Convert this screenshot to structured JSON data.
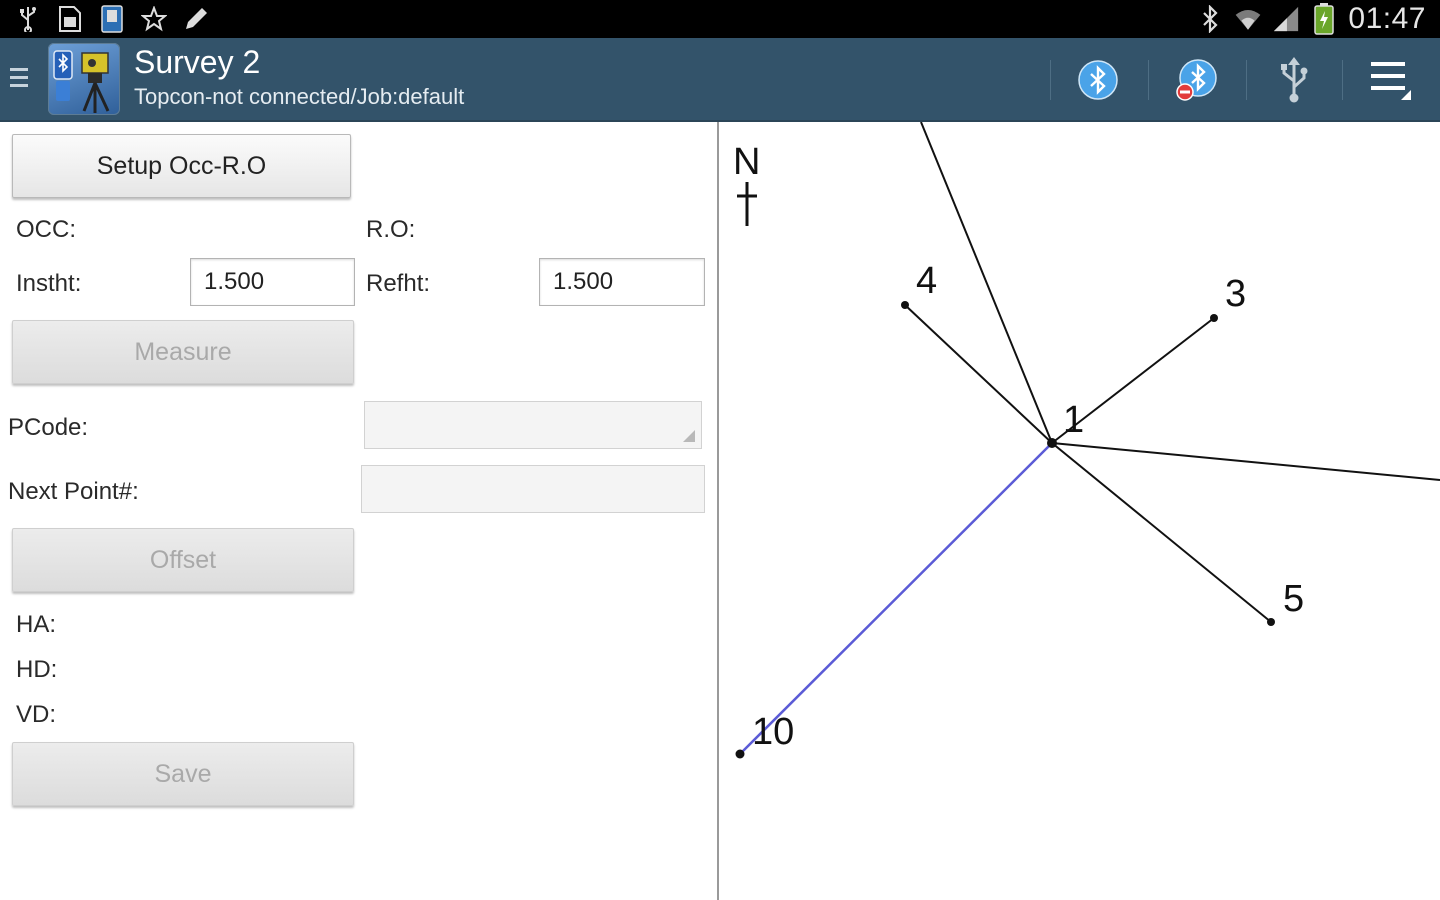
{
  "status_bar": {
    "time": "01:47",
    "left_icons": [
      "usb-icon",
      "sd-card-icon",
      "app-notification-icon",
      "star-icon",
      "pencil-icon"
    ],
    "right_icons": [
      "bluetooth-icon",
      "wifi-icon",
      "signal-icon",
      "battery-icon"
    ]
  },
  "action_bar": {
    "title": "Survey 2",
    "subtitle": "Topcon-not connected/Job:default",
    "actions": [
      "bluetooth-connect-icon",
      "bluetooth-disconnect-icon",
      "usb-connect-icon",
      "overflow-menu-icon"
    ]
  },
  "form": {
    "setup_button": "Setup Occ-R.O",
    "occ_label": "OCC:",
    "ro_label": "R.O:",
    "instht_label": "Instht:",
    "instht_value": "1.500",
    "refht_label": "Refht:",
    "refht_value": "1.500",
    "measure_button": "Measure",
    "pcode_label": "PCode:",
    "pcode_value": "",
    "next_point_label": "Next Point#:",
    "next_point_value": "",
    "offset_button": "Offset",
    "ha_label": "HA:",
    "hd_label": "HD:",
    "vd_label": "VD:",
    "save_button": "Save"
  },
  "map": {
    "north_label": "N",
    "points": [
      {
        "id": "1",
        "label": "1"
      },
      {
        "id": "3",
        "label": "3"
      },
      {
        "id": "4",
        "label": "4"
      },
      {
        "id": "5",
        "label": "5"
      },
      {
        "id": "10",
        "label": "10"
      }
    ],
    "line_color": "#111111",
    "highlight_color": "#5b5bd6"
  }
}
